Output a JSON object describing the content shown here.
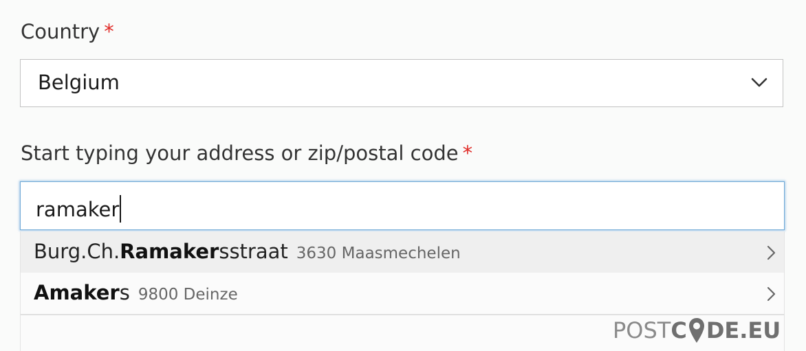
{
  "country": {
    "label": "Country",
    "required_marker": "*",
    "selected_value": "Belgium",
    "dropdown_icon": "chevron-down-icon"
  },
  "address": {
    "label": "Start typing your address or zip/postal code",
    "required_marker": "*",
    "value": "ramaker"
  },
  "suggestions": [
    {
      "prefix": "Burg.Ch.",
      "match": "Ramaker",
      "suffix": "sstraat",
      "detail": "3630 Maasmechelen",
      "icon": "chevron-right-icon"
    },
    {
      "prefix": "",
      "match": "Amaker",
      "suffix": "s",
      "detail": "9800 Deinze",
      "icon": "chevron-right-icon"
    }
  ],
  "branding": {
    "logo_text_light": "POST",
    "logo_text_bold_c": "C",
    "logo_text_bold_rest": "DE.EU",
    "colors": {
      "required": "#e02b27",
      "focus_border": "#6fa9d6",
      "logo_gray": "#6f6f6f"
    }
  }
}
